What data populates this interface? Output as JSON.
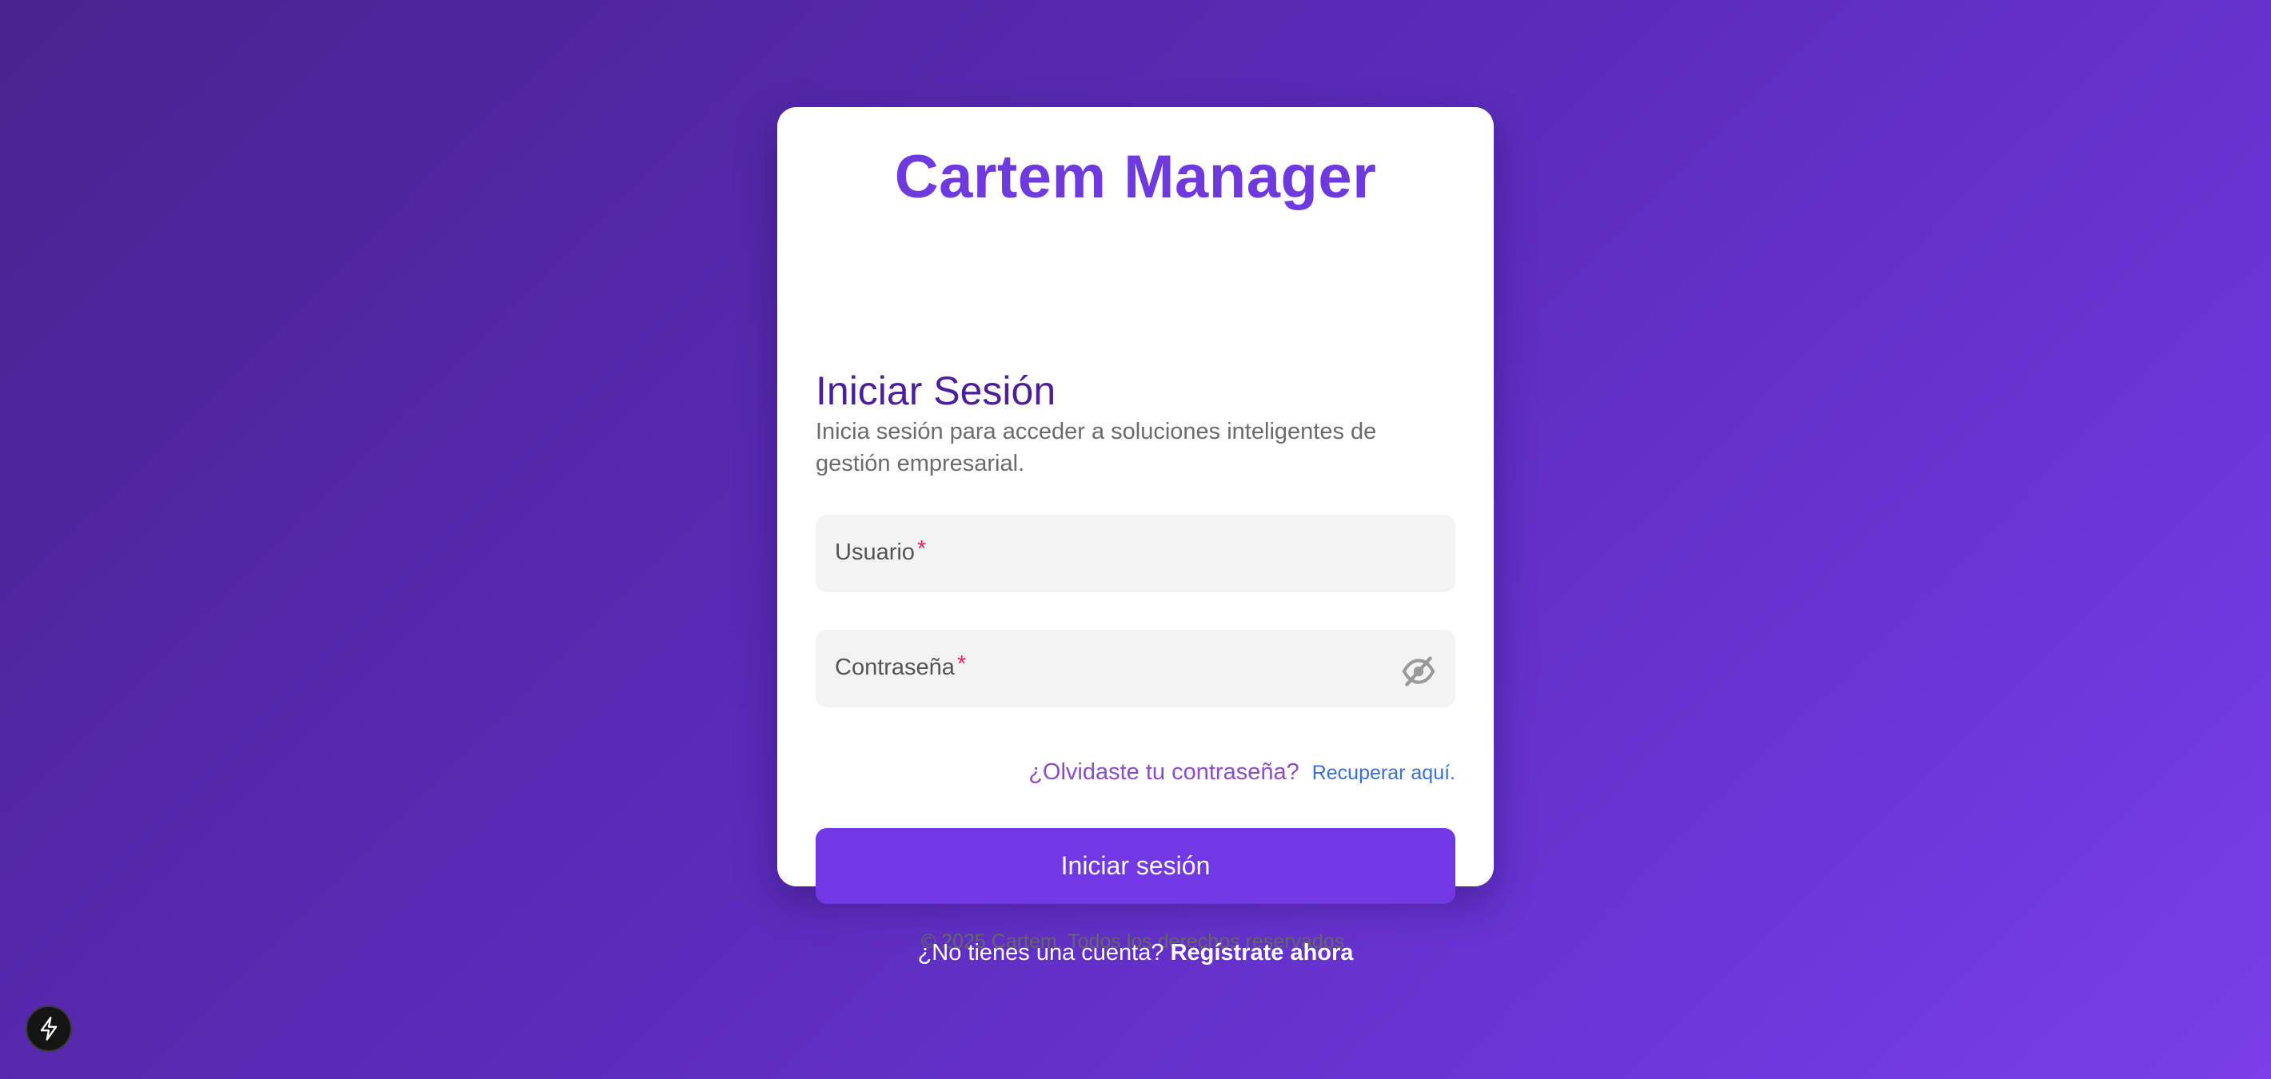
{
  "app": {
    "title": "Cartem Manager"
  },
  "login": {
    "heading": "Iniciar Sesión",
    "subtitle": "Inicia sesión para acceder a soluciones inteligentes de gestión empresarial.",
    "username": {
      "label": "Usuario",
      "required_mark": "*",
      "value": ""
    },
    "password": {
      "label": "Contraseña",
      "required_mark": "*",
      "value": "",
      "toggle_icon": "eye-off-icon"
    },
    "forgot_text": "¿Olvidaste tu contraseña?",
    "recover_link": "Recuperar aquí.",
    "submit_label": "Iniciar sesión",
    "copyright": "© 2025 Cartem. Todos los derechos reservados."
  },
  "footer": {
    "no_account_text": "¿No tienes una cuenta?",
    "register_link": "Regístrate ahora"
  },
  "fab": {
    "icon": "lightning-icon"
  },
  "colors": {
    "accent": "#7138e3",
    "title": "#6e3ae0",
    "heading": "#4a1f9a",
    "required": "#e0245e",
    "link": "#3b6fd8",
    "background_start": "#4a238f",
    "background_end": "#7a3fe8"
  }
}
